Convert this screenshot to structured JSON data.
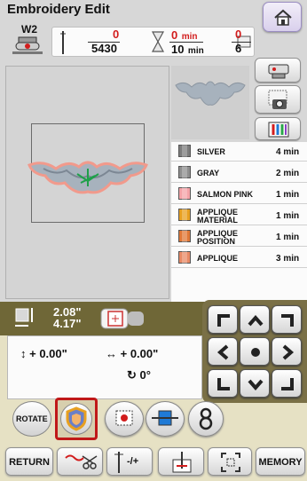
{
  "screen": {
    "title": "Embroidery Edit"
  },
  "presser_foot": {
    "label": "W2"
  },
  "stats": {
    "stitches_current": "0",
    "stitches_total": "5430",
    "time_current": "0",
    "time_total": "10",
    "time_unit": "min",
    "colors_current": "0",
    "colors_total": "6"
  },
  "threads": [
    {
      "name": "SILVER",
      "time": "4 min",
      "color": "#7c7c7c"
    },
    {
      "name": "GRAY",
      "time": "2 min",
      "color": "#8f8f8f"
    },
    {
      "name": "SALMON PINK",
      "time": "1 min",
      "color": "#f4a3a8"
    },
    {
      "name_line1": "APPLIQUE",
      "name_line2": "MATERIAL",
      "time": "1 min",
      "color": "#e8a020"
    },
    {
      "name_line1": "APPLIQUE",
      "name_line2": "POSITION",
      "time": "1 min",
      "color": "#e07838"
    },
    {
      "name": "APPLIQUE",
      "time": "3 min",
      "color": "#e88a66"
    }
  ],
  "dimensions": {
    "width": "2.08",
    "height": "4.17",
    "unit_mark": "\""
  },
  "offsets": {
    "vertical": "+ 0.00",
    "horizontal": "+ 0.00",
    "unit_mark": "\"",
    "rotation": "0°"
  },
  "buttons": {
    "rotate": "ROTATE",
    "return": "RETURN",
    "memory": "MEMORY",
    "needle_plus_minus": "-/+"
  },
  "colors": {
    "accent_red": "#c01818",
    "olive_dark": "#6f6737",
    "panel_bg": "#e6e1c4"
  },
  "icons": [
    "home-icon",
    "presser-foot-icon",
    "needle-icon",
    "hourglass-icon",
    "spool-icon",
    "embroidery-unit-icon",
    "camera-icon",
    "thread-palette-icon",
    "size-icon",
    "layout-icon",
    "applique-icon",
    "border-icon",
    "spool-change-icon",
    "number-8-icon",
    "thread-cut-icon",
    "needle-position-icon",
    "frame-icon",
    "arrow-up-icon",
    "arrow-down-icon",
    "arrow-left-icon",
    "arrow-right-icon",
    "center-icon"
  ]
}
